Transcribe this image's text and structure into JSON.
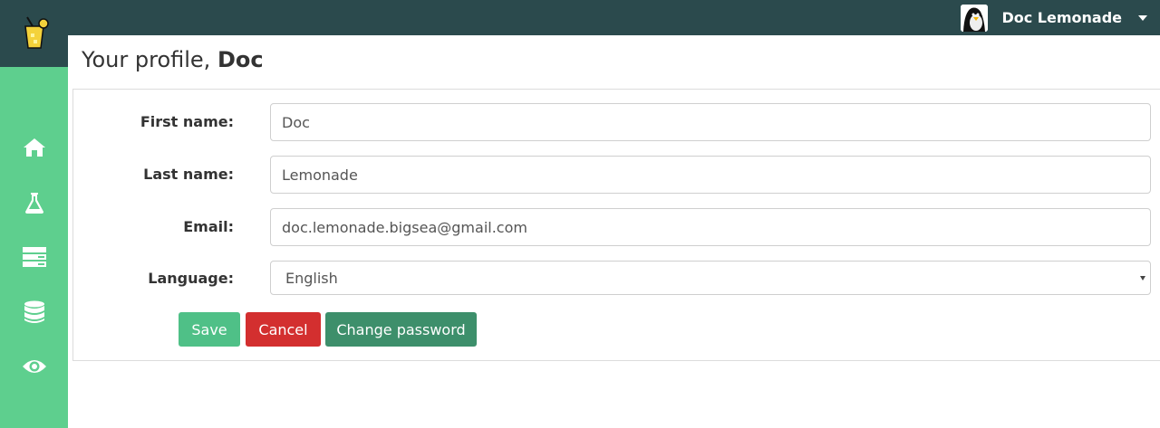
{
  "header": {
    "user_name": "Doc Lemonade"
  },
  "sidebar": {
    "items": [
      {
        "icon": "home-icon"
      },
      {
        "icon": "flask-icon"
      },
      {
        "icon": "server-icon"
      },
      {
        "icon": "database-icon"
      },
      {
        "icon": "eye-icon"
      }
    ]
  },
  "page": {
    "title_prefix": "Your profile, ",
    "title_name": "Doc"
  },
  "form": {
    "first_name_label": "First name:",
    "first_name_value": "Doc",
    "last_name_label": "Last name:",
    "last_name_value": "Lemonade",
    "email_label": "Email:",
    "email_value": "doc.lemonade.bigsea@gmail.com",
    "language_label": "Language:",
    "language_value": "English"
  },
  "buttons": {
    "save": "Save",
    "cancel": "Cancel",
    "change_password": "Change password"
  },
  "colors": {
    "topbar": "#2b4a4d",
    "sidebar": "#5ecf8e",
    "save": "#4fc087",
    "cancel": "#d32f2f",
    "change_password": "#3d8f6b"
  }
}
